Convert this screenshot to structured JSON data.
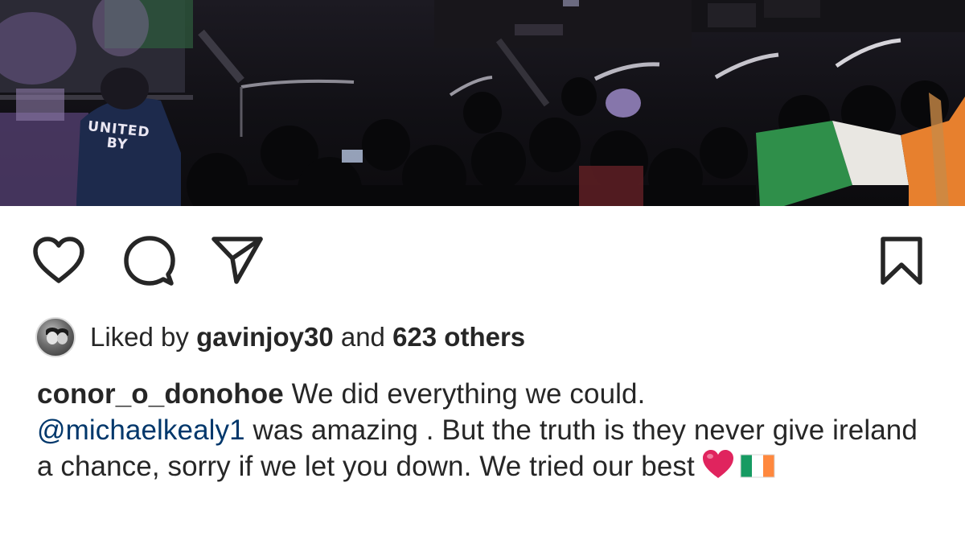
{
  "post": {
    "photo": {
      "shirt_text_line1": "UNITED",
      "shirt_text_line2": "BY"
    },
    "actions": {
      "like_icon": "heart-outline-icon",
      "comment_icon": "comment-bubble-icon",
      "share_icon": "paper-plane-icon",
      "save_icon": "bookmark-icon"
    },
    "likes": {
      "prefix": "Liked by",
      "first_user": "gavinjoy30",
      "joiner": "and",
      "others": "623 others"
    },
    "caption": {
      "username": "conor_o_donohoe",
      "text_part1": "We did everything we could.",
      "mention": "@michaelkealy1",
      "text_part2": "was amazing . But the truth is they never give ireland a chance, sorry if we let you down. We tried our best",
      "emoji_1": "red-heart-emoji",
      "emoji_2": "ireland-flag-emoji"
    }
  },
  "colors": {
    "text": "#262626",
    "mention": "#00376b",
    "heart": "#e0245e",
    "flag_green": "#169b62",
    "flag_white": "#ffffff",
    "flag_orange": "#ff883e"
  }
}
